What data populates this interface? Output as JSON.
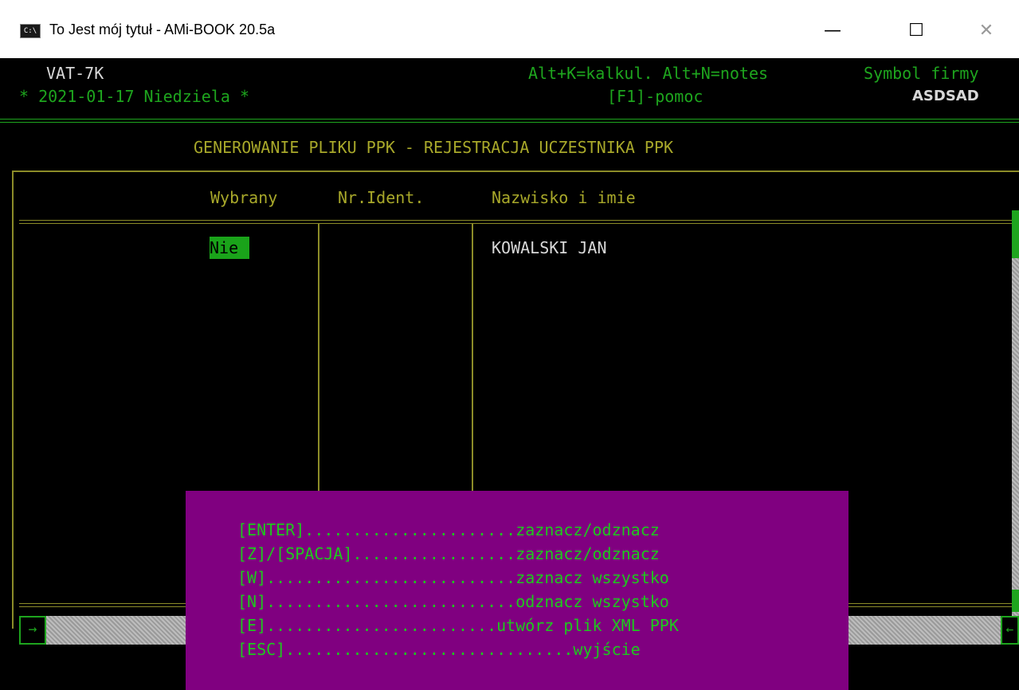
{
  "window": {
    "icon_label": "C:\\",
    "title": "To Jest mój tytuł - AMi-BOOK 20.5a",
    "minimize_glyph": "—",
    "maximize_glyph": "☐",
    "close_glyph": "✕"
  },
  "header": {
    "form": "VAT-7K",
    "date": "* 2021-01-17 Niedziela *",
    "shortcuts": "Alt+K=kalkul. Alt+N=notes",
    "company_label": "Symbol firmy",
    "help": "[F1]-pomoc",
    "company": "ASDSAD"
  },
  "screen": {
    "title": "GENEROWANIE PLIKU PPK - REJESTRACJA UCZESTNIKA PPK"
  },
  "table": {
    "columns": [
      "Wybrany",
      "Nr.Ident.",
      "Nazwisko i imie"
    ],
    "rows": [
      {
        "selected": "Nie",
        "id": "",
        "name": "KOWALSKI JAN"
      }
    ]
  },
  "scrollbar": {
    "left_arrow": "→",
    "right_arrow": "←"
  },
  "help_menu": [
    "[ENTER]......................zaznacz/odznacz",
    "[Z]/[SPACJA].................zaznacz/odznacz",
    "[W]..........................zaznacz wszystko",
    "[N]..........................odznacz wszystko",
    "[E]........................utwórz plik XML PPK",
    "[ESC]..............................wyjście"
  ]
}
